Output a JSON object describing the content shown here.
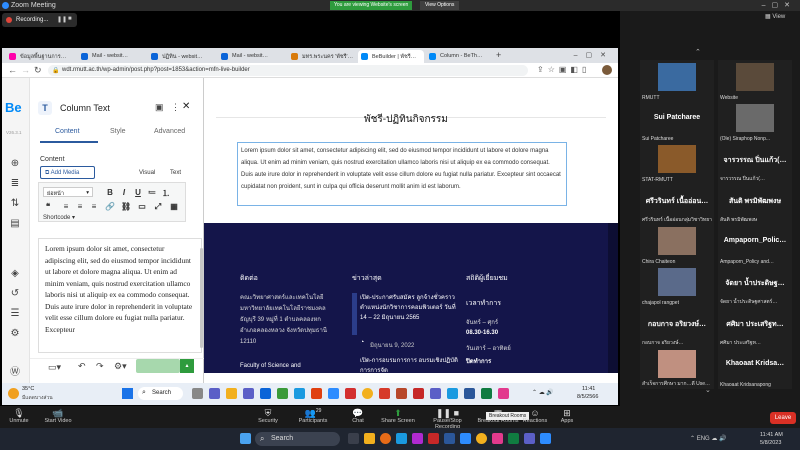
{
  "zoom": {
    "title": "Zoom Meeting",
    "viewing_notice": "You are viewing Website's screen",
    "view_options": "View Options",
    "recording": "Recording...",
    "view_label": "View",
    "controls": [
      "Unmute",
      "Start Video",
      "Security",
      "Participants",
      "Chat",
      "Share Screen",
      "Pause/Stop Recording",
      "Breakout Rooms",
      "Reactions",
      "Apps"
    ],
    "participants_count": "29",
    "tooltip": "Breakout Rooms",
    "leave": "Leave"
  },
  "chrome": {
    "tabs": [
      "ข้อมูลพื้นฐานการ…",
      "Mail - websit…",
      "ปฏิทิน - websit…",
      "Mail - websit…",
      "มทร.พระนคร 'พัชรี'…",
      "BeBuilder | พัชรี…",
      "Column - BeTh…"
    ],
    "url": "wdt.rmutt.ac.th/wp-admin/post.php?post=1853&action=mfn-live-builder"
  },
  "builder": {
    "logo": "Be",
    "version": "V26.3.1",
    "panel_title": "Column Text",
    "tabs": [
      "Content",
      "Style",
      "Advanced"
    ],
    "section": "Content",
    "add_media": "Add Media",
    "visual": "Visual",
    "text": "Text",
    "format": "ย่อหน้า",
    "shortcode": "Shortcode",
    "body_text": "Lorem ipsum dolor sit amet, consectetur adipiscing elit, sed do eiusmod tempor incididunt ut labore et dolore magna aliqua. Ut enim ad minim veniam, quis nostrud exercitation ullamco laboris nisi ut aliquip ex ea commodo consequat. Duis aute irure dolor in reprehenderit in voluptate velit esse cillum dolore eu fugiat nulla pariatur. Excepteur"
  },
  "page": {
    "heading": "พัชรี-ปฏิทินกิจกรรม",
    "lorem": "Lorem ipsum dolor sit amet, consectetur adipiscing elit, sed do eiusmod tempor incididunt ut labore et dolore magna aliqua. Ut enim ad minim veniam, quis nostrud exercitation ullamco laboris nisi ut aliquip ex ea commodo consequat. Duis aute irure dolor in reprehenderit in voluptate velit esse cillum dolore eu fugiat nulla pariatur. Excepteur sint occaecat cupidatat non proident, sunt in culpa qui officia deserunt mollit anim id est laborum.",
    "contact_h": "ติดต่อ",
    "contact_text": "คณะวิทยาศาสตร์และเทคโนโลยี มหาวิทยาลัยเทคโนโลยีราชมงคลธัญบุรี 39 หมู่ที่ 1 ตำบลคลองหก อำเภอคลองหลวง จังหวัดปทุมธานี 12110",
    "faculty": "Faculty of Science and",
    "news_h": "ข่าวล่าสุด",
    "news1": "เปิด-ประกาศรับสมัคร ลูกจ้างชั่วคราว ตำแหน่งนักวิชาการคอมพิวเตอร์ วันที่ 14 – 22 มิถุนายน 2565",
    "news1_date": "มิถุนายน 9, 2022",
    "news2": "เปิด-การอบรมการการ อบรมเชิงปฏิบัติการการจัด",
    "stats_h": "สถิติผู้เยี่ยมชม",
    "hours_h": "เวลาทำการ",
    "days": "จันทร์ – ศุกร์",
    "hours": "08.30-16.30",
    "weekend": "วันเสาร์ – อาทิตย์",
    "closed": "ปิดทำการ"
  },
  "win_task": {
    "temp": "35°C",
    "weather": "มีแดดบางส่วน",
    "search": "Search",
    "time": "11:41",
    "date": "8/5/2566"
  },
  "gallery": [
    {
      "name": "",
      "label": "RMUTT"
    },
    {
      "name": "",
      "label": "Website"
    },
    {
      "name": "Sui Patcharee",
      "label": "Sui Patcharee"
    },
    {
      "name": "",
      "label": "(Ole) Siraphop Nonp..."
    },
    {
      "name": "",
      "label": "STAT-RMUTT"
    },
    {
      "name": "จารวรรณ ปิ่นแก้ว(…",
      "label": "จารวรรณ ปิ่นแก้ว(…"
    },
    {
      "name": "ศรีวรินทร์ เนื้ออ่อน…",
      "label": "ศรีวรินทร์ เนื้ออ่อนกลุ่มวิชาวิทยาศาสตร์…"
    },
    {
      "name": "สันติ พรมิพัฒพงษ",
      "label": "สันติ พรมิพัฒพงษ"
    },
    {
      "name": "",
      "label": "Chira Chaiteon"
    },
    {
      "name": "Ampaporn_Polic…",
      "label": "Ampaporn_Policy and…"
    },
    {
      "name": "",
      "label": "chajapol rangpet"
    },
    {
      "name": "จัดยา น้ำประดิษฐ…",
      "label": "จัดยา น้ำประดิษฐศาสตร์…"
    },
    {
      "name": "กอบกาจ อริยวงษ์…",
      "label": "กอบกาจ อริยวงษ์…"
    },
    {
      "name": "ศศิมา ประเสริฐท…",
      "label": "ศศิมา ประเสริฐท…"
    },
    {
      "name": "",
      "label": "สำเร็จการศึกษา มาก…ดี Use…"
    },
    {
      "name": "Khaoaat Kridsa…",
      "label": "Khaoaat Kridsanapong"
    }
  ],
  "os_task": {
    "search": "Search",
    "weather_temp": "ENG",
    "time": "11:41 AM",
    "date": "5/8/2023"
  },
  "colors": {
    "footer_bg": "#14154a",
    "zoom_green": "#2e9b3d",
    "leave_red": "#d93025",
    "be_blue": "#0089f7"
  }
}
